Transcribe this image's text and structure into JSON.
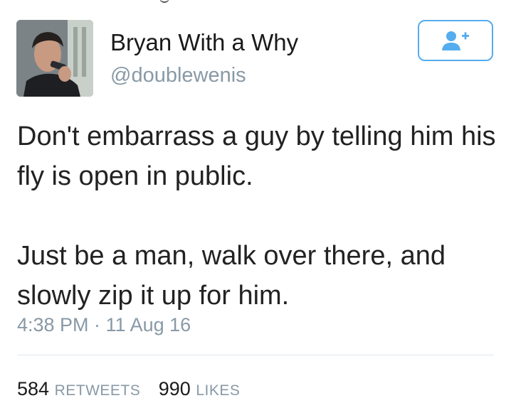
{
  "user": {
    "display_name": "Bryan With a Why",
    "handle": "@doublewenis",
    "avatar": "profile-photo"
  },
  "follow_button": {
    "icon": "follow-user-plus-icon",
    "color": "#55acee"
  },
  "tweet": {
    "paragraphs": [
      "Don't embarrass a guy by telling him his fly is open in public.",
      "Just be a man, walk over there, and slowly zip it up for him."
    ],
    "timestamp": "4:38 PM · 11 Aug 16"
  },
  "stats": {
    "retweets_count": "584",
    "retweets_label": "RETWEETS",
    "likes_count": "990",
    "likes_label": "LIKES"
  }
}
